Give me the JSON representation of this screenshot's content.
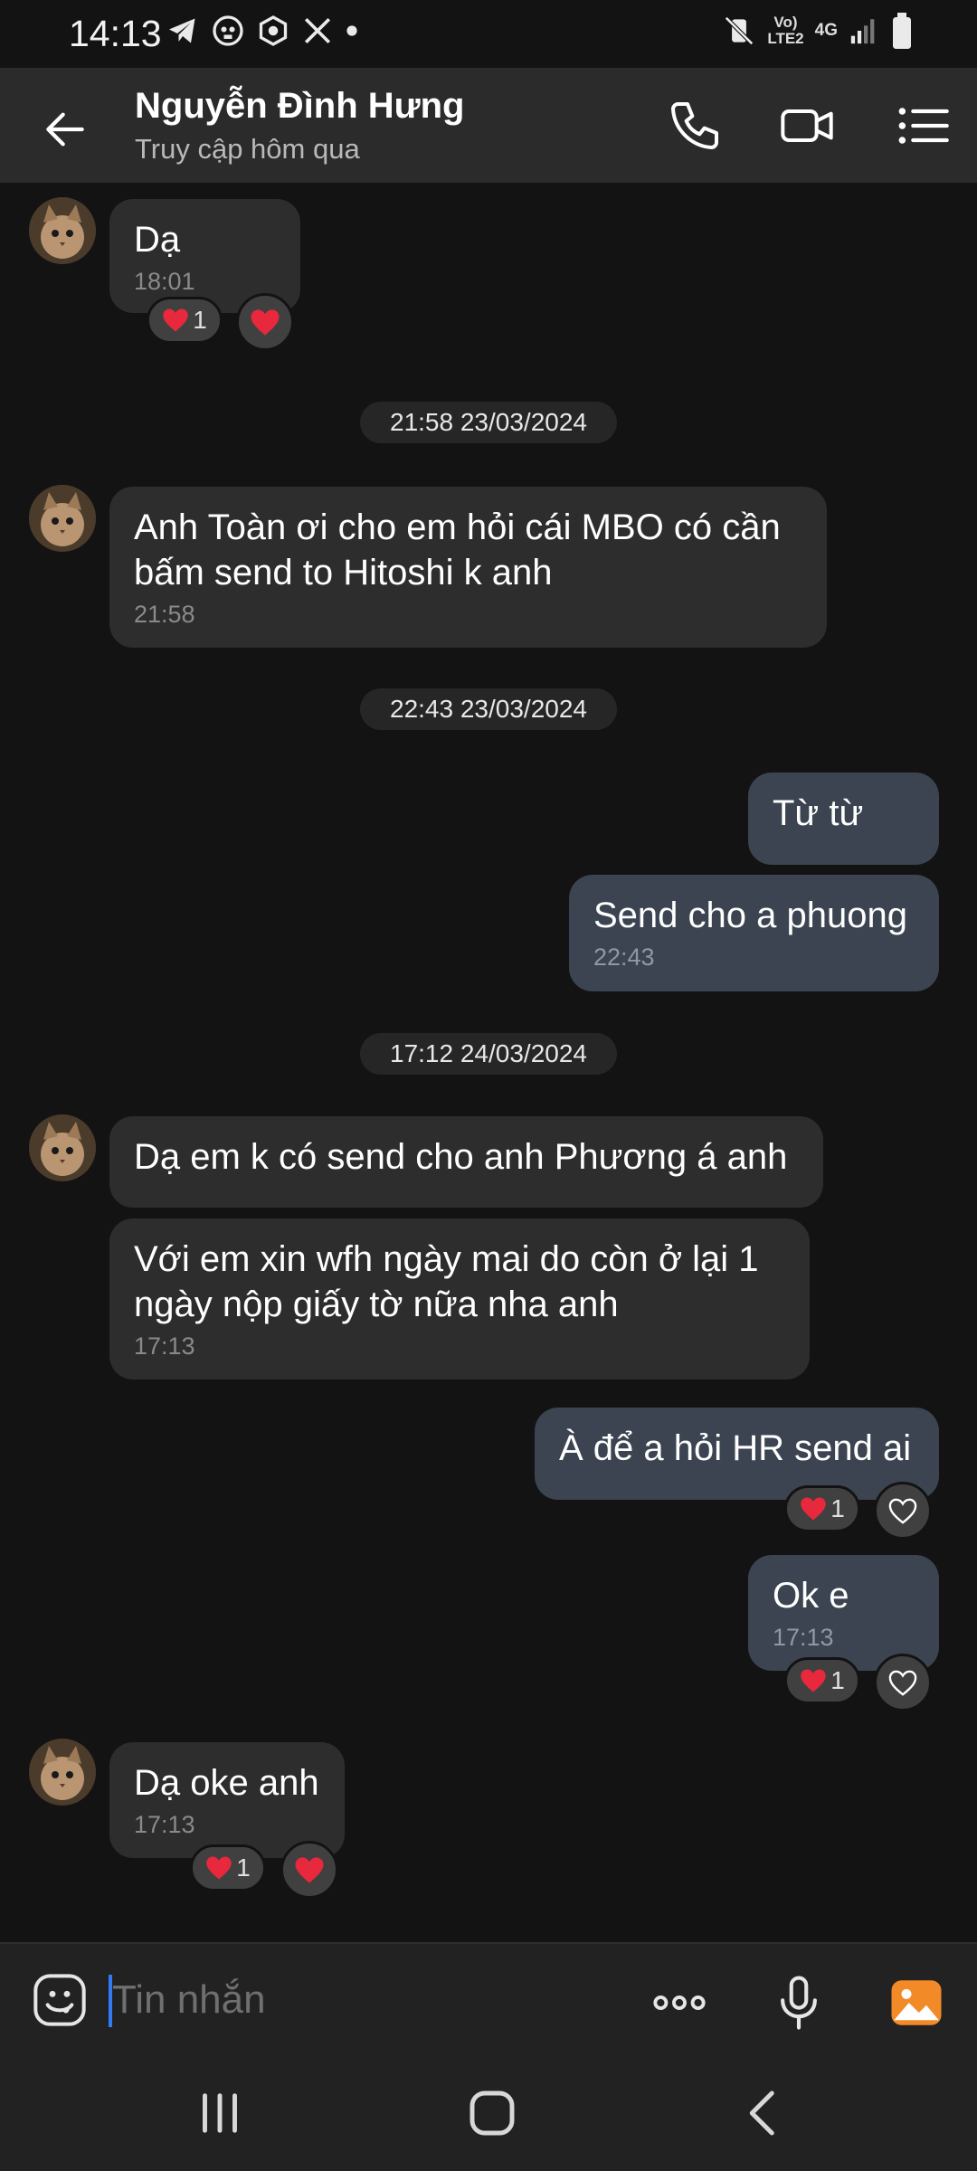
{
  "status_bar": {
    "time": "14:13",
    "network_top": "Vo)",
    "network_bottom": "LTE2",
    "net_type": "4G",
    "left_icons": [
      "telegram-icon",
      "skull-icon",
      "shield-icon",
      "x-icon",
      "dot-icon"
    ],
    "right_icons": [
      "mute-vibrate-icon",
      "signal-icon",
      "battery-icon"
    ]
  },
  "header": {
    "name": "Nguyễn Đình Hưng",
    "status": "Truy cập hôm qua",
    "icons": [
      "back-arrow-icon",
      "phone-icon",
      "video-icon",
      "menu-list-icon"
    ]
  },
  "messages": [
    {
      "id": "m1",
      "direction": "in",
      "text": "Dạ",
      "time": "18:01",
      "reaction_count": "1"
    },
    {
      "id": "d1",
      "type": "date",
      "text": "21:58 23/03/2024"
    },
    {
      "id": "m2",
      "direction": "in",
      "text": "Anh Toàn ơi cho em hỏi cái MBO có cần bấm send to Hitoshi k anh",
      "time": "21:58"
    },
    {
      "id": "d2",
      "type": "date",
      "text": "22:43 23/03/2024"
    },
    {
      "id": "m3",
      "direction": "out",
      "text": "Từ từ"
    },
    {
      "id": "m4",
      "direction": "out",
      "text": "Send cho a phuong",
      "time": "22:43"
    },
    {
      "id": "d3",
      "type": "date",
      "text": "17:12 24/03/2024"
    },
    {
      "id": "m5",
      "direction": "in",
      "text": "Dạ em k có send cho anh Phương á anh"
    },
    {
      "id": "m6",
      "direction": "in",
      "text": "Với em xin wfh ngày mai do còn ở lại 1 ngày nộp giấy tờ nữa nha anh",
      "time": "17:13"
    },
    {
      "id": "m7",
      "direction": "out",
      "text": "À để a hỏi HR send ai",
      "reaction_count": "1"
    },
    {
      "id": "m8",
      "direction": "out",
      "text": "Ok e",
      "time": "17:13",
      "reaction_count": "1"
    },
    {
      "id": "m9",
      "direction": "in",
      "text": "Dạ oke anh",
      "time": "17:13",
      "reaction_count": "1"
    }
  ],
  "composer": {
    "placeholder": "Tin nhắn",
    "icons": [
      "emoji-icon",
      "more-icon",
      "microphone-icon",
      "gallery-icon"
    ]
  },
  "nav_bar": {
    "icons": [
      "recents-icon",
      "home-icon",
      "back-icon"
    ]
  },
  "colors": {
    "background": "#131313",
    "header": "#2b2b2b",
    "bubble_in": "#2d2d2d",
    "bubble_out": "#3b4450",
    "heart": "#e8283c",
    "accent_cursor": "#2f7cf6",
    "gallery_orange": "#f28a28"
  }
}
